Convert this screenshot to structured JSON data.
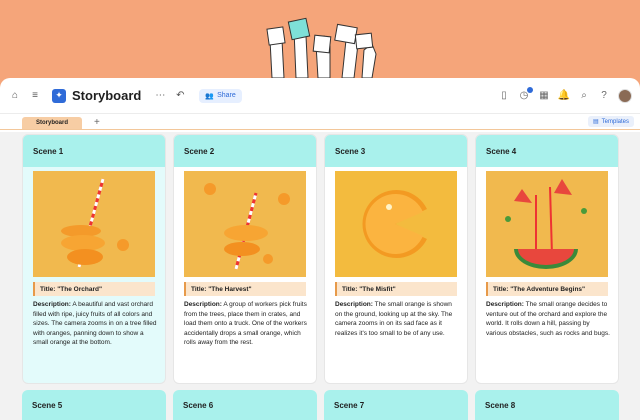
{
  "app": {
    "title": "Storyboard",
    "share_label": "Share",
    "tab_label": "Storyboard",
    "templates_label": "Templates"
  },
  "scenes": [
    {
      "label": "Scene 1",
      "title": "Title: \"The Orchard\"",
      "desc_label": "Description:",
      "desc": " A beautiful and vast orchard filled with ripe, juicy fruits of all colors and sizes. The camera zooms in on a tree filled with oranges, panning down to show a small orange at the bottom."
    },
    {
      "label": "Scene 2",
      "title": "Title: \"The Harvest\"",
      "desc_label": "Description:",
      "desc": " A group of workers pick fruits from the trees, place them in crates, and load them onto a truck. One of the workers accidentally drops a small orange, which rolls away from the rest."
    },
    {
      "label": "Scene 3",
      "title": "Title: \"The Misfit\"",
      "desc_label": "Description:",
      "desc": " The small orange is shown on the ground, looking up at the sky. The camera zooms in on its sad face as it realizes it's too small to be of any use."
    },
    {
      "label": "Scene 4",
      "title": "Title: \"The Adventure Begins\"",
      "desc_label": "Description:",
      "desc": " The small orange decides to venture out of the orchard and explore the world. It rolls down a hill, passing by various obstacles, such as rocks and bugs."
    }
  ],
  "row2": [
    "Scene 5",
    "Scene 6",
    "Scene 7",
    "Scene 8"
  ]
}
